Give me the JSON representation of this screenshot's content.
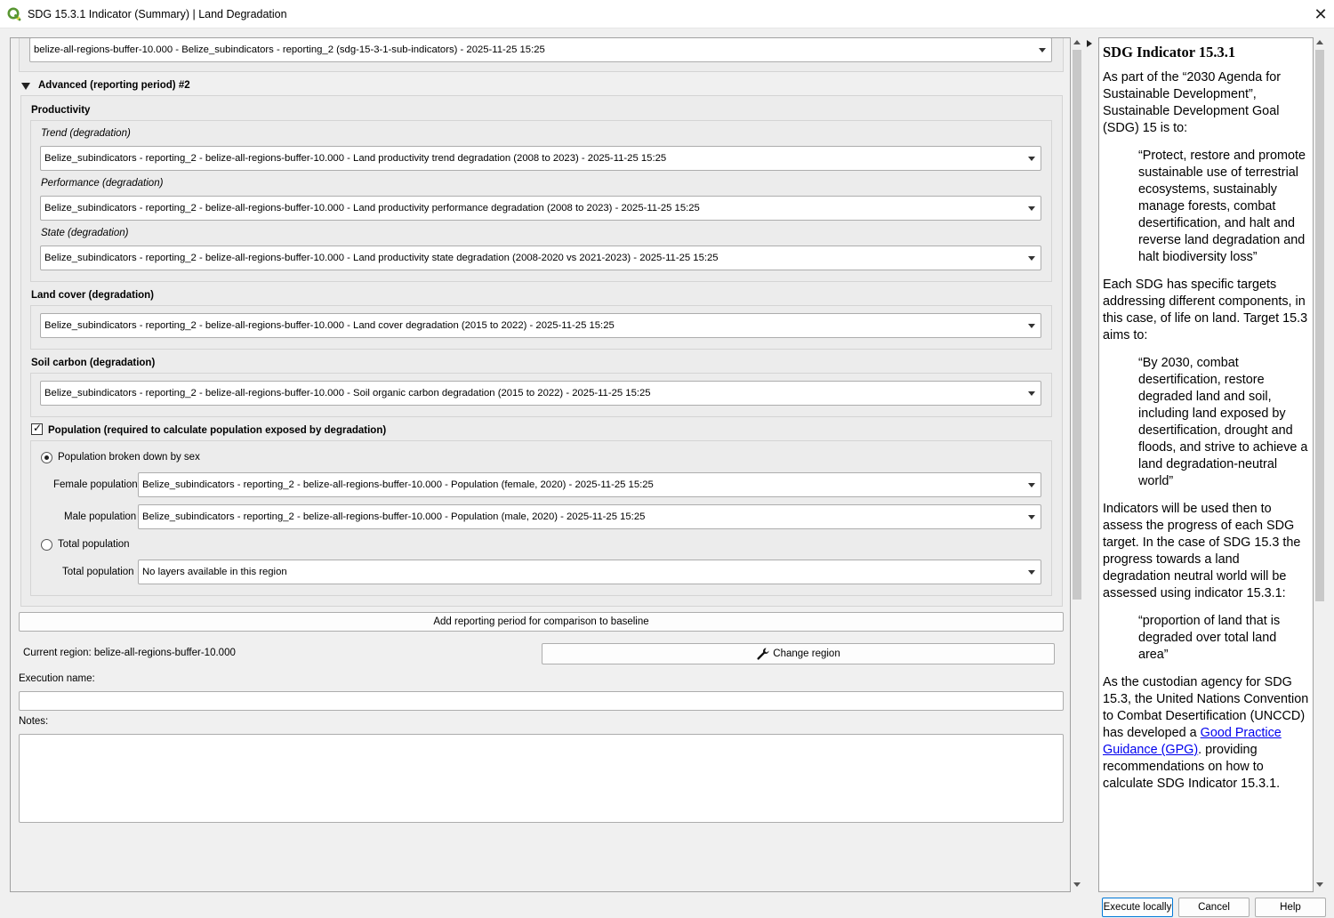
{
  "window": {
    "title": "SDG 15.3.1 Indicator (Summary) | Land Degradation",
    "close_glyph": "✕"
  },
  "top_combo": {
    "value": "belize-all-regions-buffer-10.000 - Belize_subindicators - reporting_2 (sdg-15-3-1-sub-indicators) - 2025-11-25 15:25"
  },
  "advanced": {
    "header": "Advanced (reporting period) #2",
    "productivity": {
      "title": "Productivity",
      "trend_label": "Trend (degradation)",
      "trend_value": "Belize_subindicators - reporting_2 - belize-all-regions-buffer-10.000 - Land productivity trend degradation (2008 to 2023) - 2025-11-25 15:25",
      "performance_label": "Performance (degradation)",
      "performance_value": "Belize_subindicators - reporting_2 - belize-all-regions-buffer-10.000 - Land productivity performance degradation (2008 to 2023) - 2025-11-25 15:25",
      "state_label": "State (degradation)",
      "state_value": "Belize_subindicators - reporting_2 - belize-all-regions-buffer-10.000 - Land productivity state degradation (2008-2020 vs 2021-2023) - 2025-11-25 15:25"
    },
    "land_cover": {
      "title": "Land cover (degradation)",
      "value": "Belize_subindicators - reporting_2 - belize-all-regions-buffer-10.000 - Land cover degradation (2015 to 2022) - 2025-11-25 15:25"
    },
    "soil_carbon": {
      "title": "Soil carbon (degradation)",
      "value": "Belize_subindicators - reporting_2 - belize-all-regions-buffer-10.000 - Soil organic carbon degradation (2015 to 2022) - 2025-11-25 15:25"
    },
    "population": {
      "checkbox_label": "Population (required to calculate population exposed by degradation)",
      "checked_glyph": "✓",
      "by_sex_label": "Population broken down by sex",
      "female_label": "Female population",
      "female_value": "Belize_subindicators - reporting_2 - belize-all-regions-buffer-10.000 - Population (female, 2020) - 2025-11-25 15:25",
      "male_label": "Male population",
      "male_value": "Belize_subindicators - reporting_2 - belize-all-regions-buffer-10.000 - Population (male, 2020) - 2025-11-25 15:25",
      "total_radio_label": "Total population",
      "total_label": "Total population",
      "total_value": "No layers available in this region"
    }
  },
  "add_period_button": "Add reporting period for comparison to baseline",
  "region": {
    "current_label": "Current region: belize-all-regions-buffer-10.000",
    "change_button": "Change region"
  },
  "execution_name_label": "Execution name:",
  "notes_label": "Notes:",
  "help": {
    "title": "SDG Indicator 15.3.1",
    "p1": "As part of the “2030 Agenda for Sustainable Development”, Sustainable Development Goal (SDG) 15 is to:",
    "q1": "“Protect, restore and promote sustainable use of terrestrial ecosystems, sustainably manage forests, combat desertification, and halt and reverse land degradation and halt biodiversity loss”",
    "p2": "Each SDG has specific targets addressing different components, in this case, of life on land. Target 15.3 aims to:",
    "q2": "“By 2030, combat desertification, restore degraded land and soil, including land exposed by desertification, drought and floods, and strive to achieve a land degradation-neutral world”",
    "p3": "Indicators will be used then to assess the progress of each SDG target. In the case of SDG 15.3 the progress towards a land degradation neutral world will be assessed using indicator 15.3.1:",
    "q3": "“proportion of land that is degraded over total land area”",
    "p4_pre": "As the custodian agency for SDG 15.3, the United Nations Convention to Combat Desertification (UNCCD) has developed a ",
    "p4_link": "Good Practice Guidance (GPG)",
    "p4_post": ". providing recommendations on how to calculate SDG Indicator 15.3.1."
  },
  "footer": {
    "execute": "Execute locally",
    "cancel": "Cancel",
    "help": "Help"
  },
  "colors": {
    "qgis_green": "#589632",
    "link": "#0000ee"
  }
}
